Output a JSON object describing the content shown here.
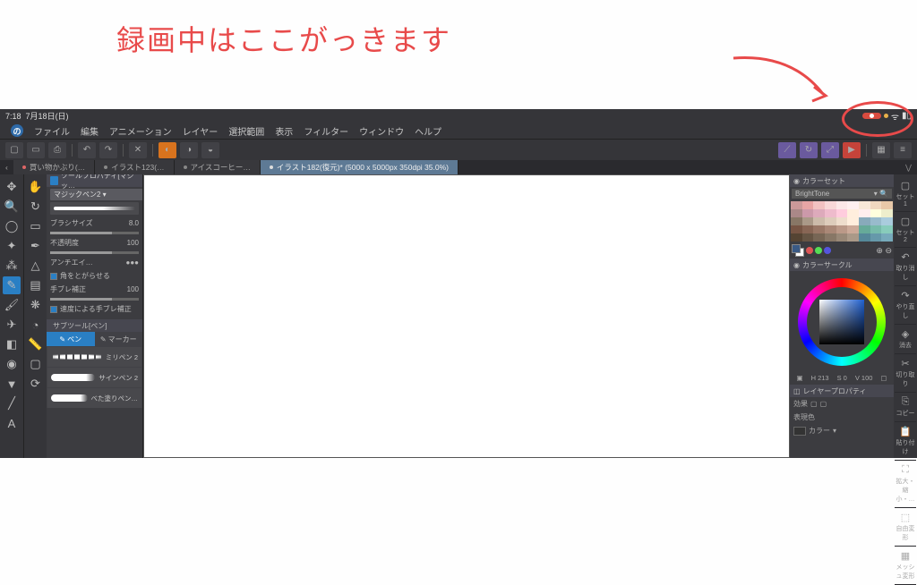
{
  "annotation": "録画中はここがっきます",
  "status": {
    "time": "7:18",
    "date": "7月18日(日)"
  },
  "menu": [
    "ファイル",
    "編集",
    "アニメーション",
    "レイヤー",
    "選択範囲",
    "表示",
    "フィルター",
    "ウィンドウ",
    "ヘルプ"
  ],
  "tabs": [
    {
      "label": "買い物かぶり(…",
      "active": false
    },
    {
      "label": "イラスト123(…",
      "active": false
    },
    {
      "label": "アイスコーヒー…",
      "active": false
    },
    {
      "label": "イラスト182(復元)* (5000 x 5000px 350dpi 35.0%)",
      "active": true
    }
  ],
  "tool_property": {
    "title": "ツールプロパティ[マジッ…",
    "preset": "マジックペン2",
    "brush_size_label": "ブラシサイズ",
    "brush_size": "8.0",
    "opacity_label": "不透明度",
    "opacity": "100",
    "antialias_label": "アンチエイ…",
    "corner_label": "角をとがらせる",
    "stabilize_label": "手ブレ補正",
    "stabilize": "100",
    "speed_label": "速度による手ブレ補正"
  },
  "subtool": {
    "title": "サブツール[ペン]",
    "tab1": "ペン",
    "tab2": "マーカー",
    "brushes": [
      "ミリペン 2",
      "サインペン 2",
      "べた塗りペン…"
    ]
  },
  "color_set": {
    "title": "カラーセット",
    "name": "BrightTone"
  },
  "swatches_colors": [
    "#c99",
    "#e8a5a5",
    "#f2c2c2",
    "#f8d8d8",
    "#fce8e8",
    "#fff0f0",
    "#f8e8d8",
    "#f0d8c0",
    "#e8c8a8",
    "#a88",
    "#c9a",
    "#dab",
    "#ebc",
    "#fcd",
    "#fed",
    "#fee",
    "#ffd",
    "#eec",
    "#876",
    "#a98",
    "#cba",
    "#dcb",
    "#edc",
    "#fed",
    "#8ab",
    "#9bc",
    "#acd",
    "#754",
    "#865",
    "#976",
    "#a87",
    "#b98",
    "#ca9",
    "#6a9",
    "#7ba",
    "#8cb",
    "#543",
    "#654",
    "#765",
    "#876",
    "#987",
    "#a98",
    "#589",
    "#69a",
    "#7ab"
  ],
  "small_colors": [
    "#d55",
    "#5d5",
    "#55d"
  ],
  "circle": {
    "title": "カラーサークル",
    "h": "H 213",
    "s": "S 0",
    "v": "V 100"
  },
  "layer_prop": {
    "title": "レイヤープロパティ",
    "effect": "効果",
    "display": "表現色",
    "color": "カラー"
  },
  "right_side": [
    "セット1",
    "セット2",
    "取り消し",
    "やり直し",
    "消去",
    "切り取り",
    "コピー",
    "貼り付け",
    "拡大・縮小・…",
    "自由変形",
    "メッシュ変形"
  ],
  "right_icons": [
    "",
    "",
    "↶",
    "↷",
    "◈",
    "✂",
    "⎘",
    "📋",
    "⛶",
    "⬚",
    "▦"
  ]
}
